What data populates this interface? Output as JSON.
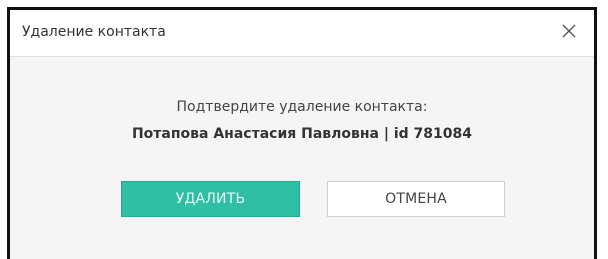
{
  "dialog": {
    "title": "Удаление контакта",
    "close_icon": "close-icon",
    "prompt": "Подтвердите удаление контакта:",
    "contact_line": "Потапова Анастасия Павловна | id 781084",
    "delete_label": "УДАЛИТЬ",
    "cancel_label": "ОТМЕНА"
  },
  "colors": {
    "accent": "#2fbfa4",
    "text": "#333333",
    "background": "#f5f5f5"
  }
}
